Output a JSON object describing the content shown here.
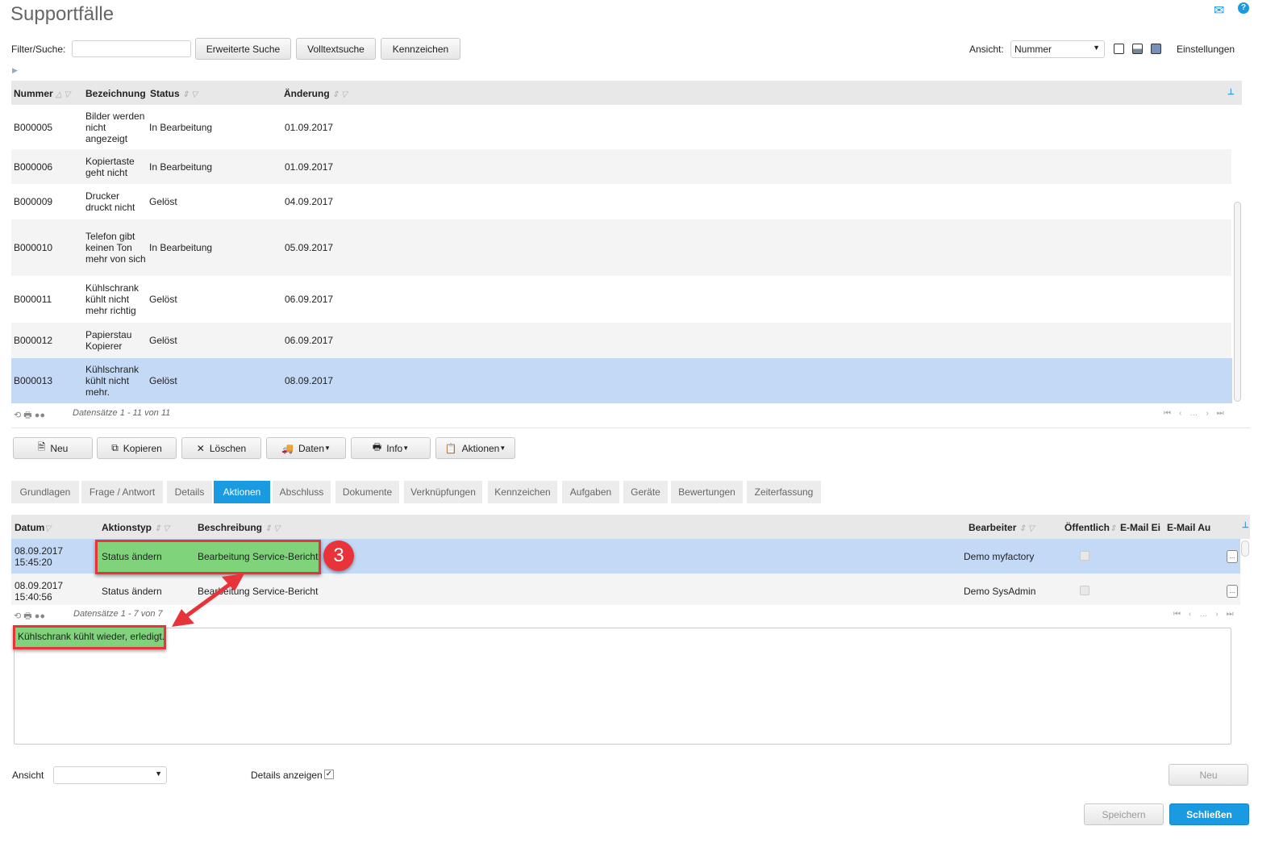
{
  "title": "Supportfälle",
  "header_icons": [
    "mail-icon",
    "help-icon"
  ],
  "filter": {
    "label": "Filter/Suche:",
    "value": "",
    "buttons": [
      "Erweiterte Suche",
      "Volltextsuche",
      "Kennzeichen"
    ]
  },
  "view": {
    "label": "Ansicht:",
    "selected": "Nummer",
    "settings": "Einstellungen"
  },
  "cases": {
    "columns": [
      "Nummer",
      "Bezeichnung",
      "Status",
      "Änderung"
    ],
    "rows": [
      {
        "nummer": "B000005",
        "bezeichnung": "Bilder werden nicht angezeigt",
        "status": "In Bearbeitung",
        "aenderung": "01.09.2017"
      },
      {
        "nummer": "B000006",
        "bezeichnung": "Kopiertaste geht nicht",
        "status": "In Bearbeitung",
        "aenderung": "01.09.2017"
      },
      {
        "nummer": "B000009",
        "bezeichnung": "Drucker druckt nicht",
        "status": "Gelöst",
        "aenderung": "04.09.2017"
      },
      {
        "nummer": "B000010",
        "bezeichnung": "Telefon gibt keinen Ton mehr von sich",
        "status": "In Bearbeitung",
        "aenderung": "05.09.2017"
      },
      {
        "nummer": "B000011",
        "bezeichnung": "Kühlschrank kühlt nicht mehr richtig",
        "status": "Gelöst",
        "aenderung": "06.09.2017"
      },
      {
        "nummer": "B000012",
        "bezeichnung": "Papierstau Kopierer",
        "status": "Gelöst",
        "aenderung": "06.09.2017"
      },
      {
        "nummer": "B000013",
        "bezeichnung": "Kühlschrank kühlt nicht mehr.",
        "status": "Gelöst",
        "aenderung": "08.09.2017",
        "selected": true
      }
    ],
    "footer": "Datensätze 1 - 11 von 11"
  },
  "toolbar": [
    "Neu",
    "Kopieren",
    "Löschen",
    "Daten",
    "Info",
    "Aktionen"
  ],
  "tabs": [
    "Grundlagen",
    "Frage / Antwort",
    "Details",
    "Aktionen",
    "Abschluss",
    "Dokumente",
    "Verknüpfungen",
    "Kennzeichen",
    "Aufgaben",
    "Geräte",
    "Bewertungen",
    "Zeiterfassung"
  ],
  "active_tab": "Aktionen",
  "actions": {
    "columns": [
      "Datum",
      "Aktionstyp",
      "Beschreibung",
      "Bearbeiter",
      "Öffentlich",
      "E-Mail Ei",
      "E-Mail Au"
    ],
    "rows": [
      {
        "datum": "08.09.2017",
        "zeit": "15:45:20",
        "typ": "Status ändern",
        "beschreibung": "Bearbeitung Service-Bericht",
        "bearbeiter": "Demo myfactory",
        "oeffentlich": false,
        "selected": true
      },
      {
        "datum": "08.09.2017",
        "zeit": "15:40:56",
        "typ": "Status ändern",
        "beschreibung": "Bearbeitung Service-Bericht",
        "bearbeiter": "Demo SysAdmin",
        "oeffentlich": false
      }
    ],
    "footer": "Datensätze 1 - 7 von 7"
  },
  "details_text": "Kühlschrank kühlt wieder, erledigt.",
  "annotation": "3",
  "bottom": {
    "ansicht_label": "Ansicht",
    "ansicht_value": "",
    "details_label": "Details anzeigen",
    "details_checked": true,
    "neu": "Neu",
    "speichern": "Speichern",
    "schliessen": "Schließen"
  },
  "colors": {
    "accent": "#1a9ae0",
    "selected_row": "#c4d9f5",
    "highlight": "#7fd37a",
    "annotation_red": "#e8333a"
  }
}
